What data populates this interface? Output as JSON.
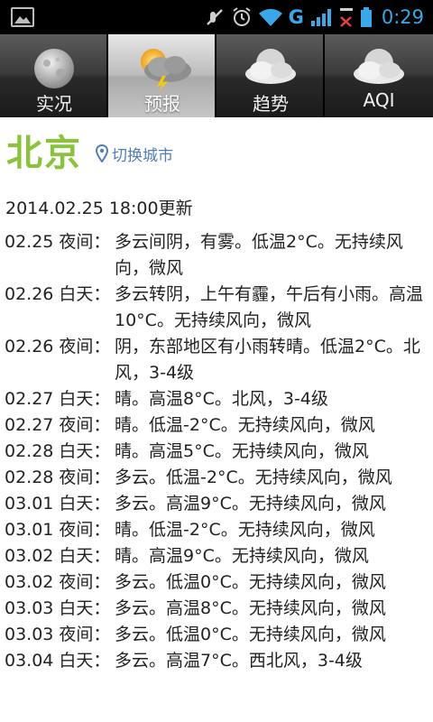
{
  "status_bar": {
    "time": "0:29",
    "network_label": "G",
    "colors": {
      "accent": "#3aa8e8"
    },
    "icons": [
      "gallery-icon",
      "mute-icon",
      "alarm-icon",
      "wifi-icon",
      "signal-sim1-icon",
      "signal-sim2-icon",
      "battery-icon"
    ]
  },
  "tabs": [
    {
      "label": "实况",
      "icon": "moon-icon",
      "active": false
    },
    {
      "label": "预报",
      "icon": "thunderstorm-sun-icon",
      "active": true
    },
    {
      "label": "趋势",
      "icon": "cloudy-moon-icon",
      "active": false
    },
    {
      "label": "AQI",
      "icon": "cloudy-moon-icon",
      "active": false
    }
  ],
  "city": {
    "name": "北京",
    "switch_label": "切换城市",
    "switch_icon": "location-pin-icon"
  },
  "update_time": "2014.02.25 18:00更新",
  "forecast": [
    {
      "date": "02.25 夜间：",
      "desc": "多云间阴，有雾。低温2°C。无持续风向，微风"
    },
    {
      "date": "02.26 白天：",
      "desc": "多云转阴，上午有霾，午后有小雨。高温10°C。无持续风向，微风"
    },
    {
      "date": "02.26 夜间：",
      "desc": "阴，东部地区有小雨转晴。低温2°C。北风，3-4级"
    },
    {
      "date": "02.27 白天：",
      "desc": "晴。高温8°C。北风，3-4级"
    },
    {
      "date": "02.27 夜间：",
      "desc": "晴。低温-2°C。无持续风向，微风"
    },
    {
      "date": "02.28 白天：",
      "desc": "晴。高温5°C。无持续风向，微风"
    },
    {
      "date": "02.28 夜间：",
      "desc": "多云。低温-2°C。无持续风向，微风"
    },
    {
      "date": "03.01 白天：",
      "desc": "多云。高温9°C。无持续风向，微风"
    },
    {
      "date": "03.01 夜间：",
      "desc": "晴。低温-2°C。无持续风向，微风"
    },
    {
      "date": "03.02 白天：",
      "desc": "晴。高温9°C。无持续风向，微风"
    },
    {
      "date": "03.02 夜间：",
      "desc": "多云。低温0°C。无持续风向，微风"
    },
    {
      "date": "03.03 白天：",
      "desc": "多云。高温8°C。无持续风向，微风"
    },
    {
      "date": "03.03 夜间：",
      "desc": "多云。低温0°C。无持续风向，微风"
    },
    {
      "date": "03.04 白天：",
      "desc": "多云。高温7°C。西北风，3-4级"
    }
  ],
  "colors": {
    "city_green": "#8ac23c",
    "link_blue": "#4f7fb5"
  }
}
